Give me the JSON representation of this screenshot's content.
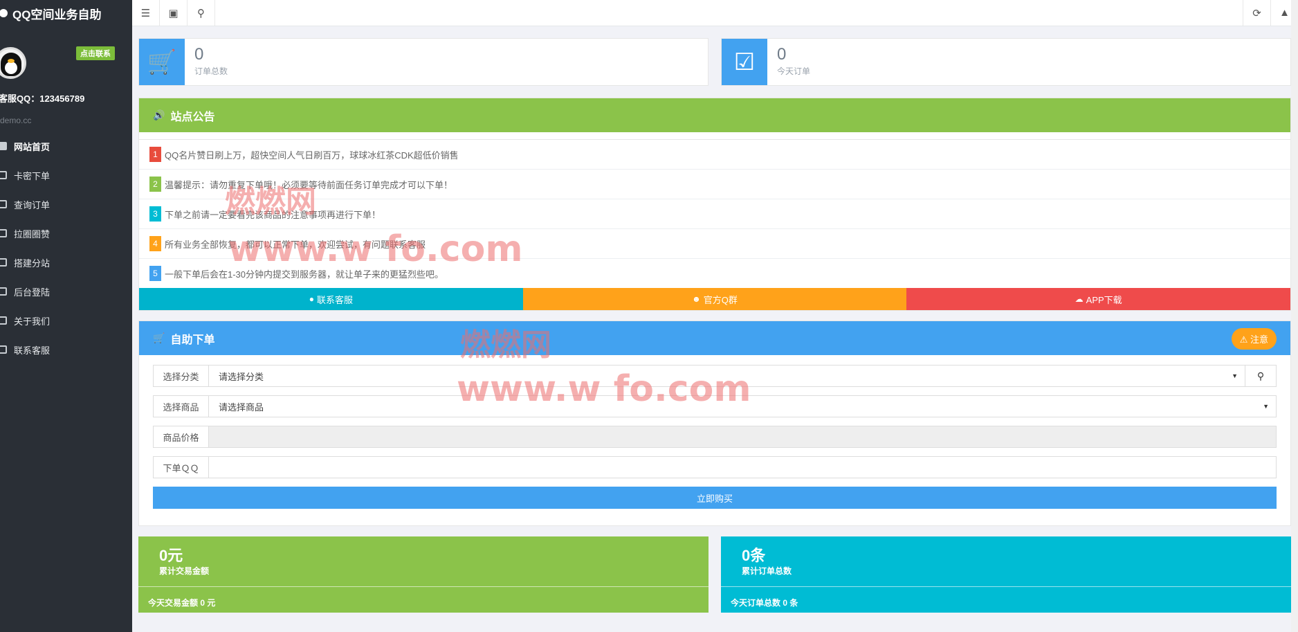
{
  "app": {
    "title": "QQ空间业务自助"
  },
  "sidebar": {
    "contact_badge": "点击联系",
    "service_qq": "客服QQ：123456789",
    "domain": "demo.cc",
    "items": [
      {
        "label": "网站首页",
        "icon": "home-icon"
      },
      {
        "label": "卡密下单",
        "icon": "card-icon"
      },
      {
        "label": "查询订单",
        "icon": "search-icon"
      },
      {
        "label": "拉圈圈赞",
        "icon": "circle-icon"
      },
      {
        "label": "搭建分站",
        "icon": "tag-icon"
      },
      {
        "label": "后台登陆",
        "icon": "user-icon"
      },
      {
        "label": "关于我们",
        "icon": "heart-icon"
      },
      {
        "label": "联系客服",
        "icon": "chat-icon"
      }
    ]
  },
  "topbar": {
    "icons": [
      "list-icon",
      "card-icon",
      "search-icon",
      "refresh-icon",
      "bell-icon"
    ]
  },
  "stats": {
    "orders_total": {
      "value": "0",
      "label": "订单总数"
    },
    "orders_today": {
      "value": "0",
      "label": "今天订单"
    }
  },
  "notice": {
    "title": "站点公告",
    "items": [
      {
        "num": "1",
        "color": "#e84c3d",
        "text": "QQ名片赞日刷上万，超快空间人气日刷百万，球球冰红茶CDK超低价销售"
      },
      {
        "num": "2",
        "color": "#8bc34a",
        "text": "温馨提示：请勿重复下单哦！必须要等待前面任务订单完成才可以下单！"
      },
      {
        "num": "3",
        "color": "#00bcd4",
        "text": "下单之前请一定要看完该商品的注意事项再进行下单！"
      },
      {
        "num": "4",
        "color": "#ffa21a",
        "text": "所有业务全部恢复，都可以正常下单，欢迎尝试，有问题联系客服"
      },
      {
        "num": "5",
        "color": "#42a2f0",
        "text": "一般下单后会在1-30分钟内提交到服务器，就让单子来的更猛烈些吧。"
      }
    ],
    "actions": [
      {
        "label": "联系客服",
        "color": "#00b3cc"
      },
      {
        "label": "官方Q群",
        "color": "#ffa21a"
      },
      {
        "label": "APP下载",
        "color": "#ef4b4b"
      }
    ]
  },
  "order": {
    "title": "自助下单",
    "notice_button": "注意",
    "fields": {
      "category": {
        "label": "选择分类",
        "value": "请选择分类"
      },
      "product": {
        "label": "选择商品",
        "value": "请选择商品"
      },
      "price": {
        "label": "商品价格",
        "value": ""
      },
      "qq": {
        "label": "下单ＱＱ",
        "value": ""
      }
    },
    "buy_button": "立即购买"
  },
  "totals": {
    "amount": {
      "value": "0元",
      "label": "累计交易金额",
      "today": "今天交易金额 0 元"
    },
    "count": {
      "value": "0条",
      "label": "累计订单总数",
      "today": "今天订单总数 0 条"
    }
  },
  "watermark": {
    "url1": "www.w    fo.com",
    "url2": "www.w    fo.com",
    "cjk": "燃燃网"
  }
}
